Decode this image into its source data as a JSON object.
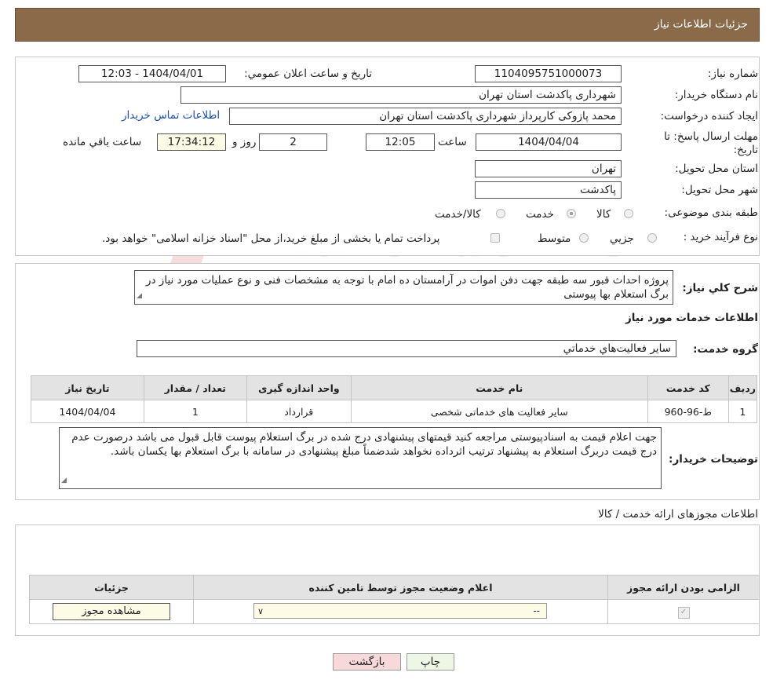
{
  "header": {
    "title": "جزئیات اطلاعات نیاز"
  },
  "watermark": {
    "text": "AriaTender.neT"
  },
  "form": {
    "need_number": {
      "label": "شماره نیاز:",
      "value": "1104095751000073"
    },
    "announce_datetime": {
      "label": "تاریخ و ساعت اعلان عمومي:",
      "value": "1404/04/01 - 12:03"
    },
    "buyer_org": {
      "label": "نام دستگاه خريدار:",
      "value": "شهرداری پاکدشت استان تهران"
    },
    "requester": {
      "label": "ايجاد کننده درخواست:",
      "value": "محمد پازوکی کارپرداز شهرداری پاکدشت استان تهران"
    },
    "contact_link": "اطلاعات تماس خريدار",
    "deadline": {
      "label": "مهلت ارسال پاسخ: تا تاریخ:",
      "date": "1404/04/04",
      "time_label": "ساعت",
      "time": "12:05",
      "days": "2",
      "days_label": "روز و",
      "remaining": "17:34:12",
      "remaining_label": "ساعت باقي مانده"
    },
    "province": {
      "label": "استان محل تحويل:",
      "value": "تهران"
    },
    "city": {
      "label": "شهر محل تحويل:",
      "value": "پاکدشت"
    },
    "category": {
      "label": "طبقه بندی موضوعی:",
      "options": [
        "کالا",
        "خدمت",
        "کالا/خدمت"
      ],
      "selected": "خدمت"
    },
    "purchase_type": {
      "label": "نوع فرآيند خريد :",
      "options": [
        "جزيي",
        "متوسط"
      ],
      "note": "پرداخت تمام یا بخشی از مبلغ خرید،از محل \"اسناد خزانه اسلامی\" خواهد بود."
    }
  },
  "summary": {
    "label": "شرح کلي نياز:",
    "text": "پروژه احداث قبور سه طبقه جهت دفن اموات در آرامستان ده امام با توجه به مشخصات فنی و نوع عملیات مورد نیاز در برگ استعلام بها پیوستی"
  },
  "services_title": "اطلاعات خدمات مورد نياز",
  "service_group": {
    "label": "گروه خدمت:",
    "value": "ساير فعاليت‌هاي خدماتي"
  },
  "services_table": {
    "headers": [
      "رديف",
      "کد خدمت",
      "نام خدمت",
      "واحد اندازه گيری",
      "تعداد / مقدار",
      "تاريخ نياز"
    ],
    "rows": [
      [
        "1",
        "ط-96-960",
        "سایر فعالیت های خدماتی شخصی",
        "قرارداد",
        "1",
        "1404/04/04"
      ]
    ]
  },
  "buyer_notes": {
    "label": "توضيحات خريدار:",
    "text": "جهت اعلام قیمت به اسنادپیوستی مراجعه کنید قیمتهای پیشنهادی درج شده در برگ استعلام پیوست قابل قبول می باشد درصورت عدم درج قیمت دربرگ استعلام به پیشنهاد ترتیب اثرداده نخواهد شدضمناً مبلغ پیشنهادی در سامانه با برگ استعلام بها یکسان باشد."
  },
  "permits": {
    "title": "اطلاعات مجوزهای ارائه خدمت / کالا",
    "headers": [
      "الزامی بودن ارائه مجوز",
      "اعلام وضعيت مجوز توسط تامين کننده",
      "جزئيات"
    ],
    "select_value": "--",
    "view_button": "مشاهده مجوز"
  },
  "buttons": {
    "print": "چاپ",
    "back": "بازگشت"
  },
  "colors": {
    "header_bg": "#8B6A4A",
    "link": "#1a4fb5",
    "back_button": "#f7d9d9",
    "print_button": "#eef7e6"
  }
}
